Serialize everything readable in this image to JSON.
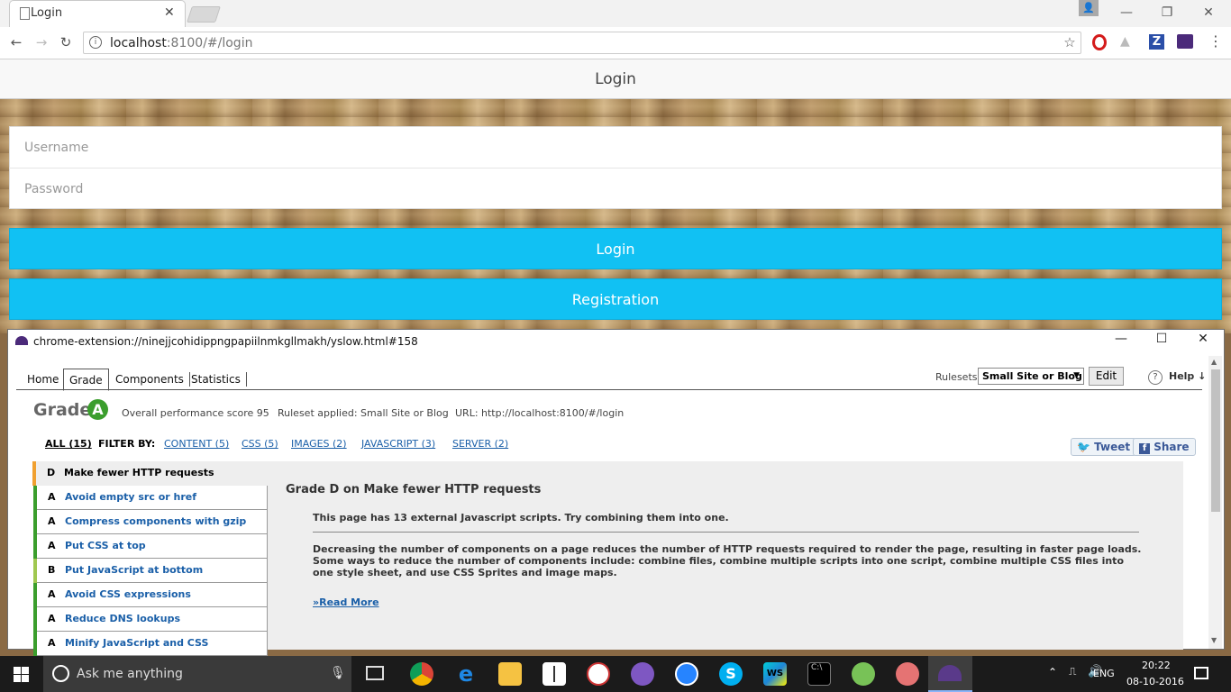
{
  "browser": {
    "tab_title": "Login",
    "url_host": "localhost",
    "url_rest": ":8100/#/login",
    "extensions": [
      "opera-icon",
      "drive-icon",
      "zotero-icon",
      "yslow-icon"
    ]
  },
  "app": {
    "header_title": "Login",
    "username_placeholder": "Username",
    "password_placeholder": "Password",
    "login_button": "Login",
    "registration_button": "Registration",
    "primary_color": "#11c1f3"
  },
  "popup": {
    "title": "chrome-extension://ninejjcohidippngpapiilnmkgllmakh/yslow.html#158",
    "tabs": [
      "Home",
      "Grade",
      "Components",
      "Statistics"
    ],
    "active_tab": "Grade",
    "rulesets_label": "Rulesets",
    "ruleset_value": "Small Site or Blog",
    "edit_button": "Edit",
    "help_label": "Help ↓",
    "grade_label": "Grade",
    "grade_letter": "A",
    "score_text": "Overall performance score 95",
    "ruleset_applied": "Ruleset applied: Small Site or Blog",
    "url_text": "URL: http://localhost:8100/#/login",
    "filter_all": "ALL (15)",
    "filter_by": "FILTER BY:",
    "filters": [
      "CONTENT (5)",
      "CSS (5)",
      "IMAGES (2)",
      "JAVASCRIPT (3)",
      "SERVER (2)"
    ],
    "tweet": "Tweet",
    "share": "Share",
    "rules": [
      {
        "grade": "D",
        "name": "Make fewer HTTP requests",
        "color": "#f0a030"
      },
      {
        "grade": "A",
        "name": "Avoid empty src or href",
        "color": "#3b9e2d"
      },
      {
        "grade": "A",
        "name": "Compress components with gzip",
        "color": "#3b9e2d"
      },
      {
        "grade": "A",
        "name": "Put CSS at top",
        "color": "#3b9e2d"
      },
      {
        "grade": "B",
        "name": "Put JavaScript at bottom",
        "color": "#a0c850"
      },
      {
        "grade": "A",
        "name": "Avoid CSS expressions",
        "color": "#3b9e2d"
      },
      {
        "grade": "A",
        "name": "Reduce DNS lookups",
        "color": "#3b9e2d"
      },
      {
        "grade": "A",
        "name": "Minify JavaScript and CSS",
        "color": "#3b9e2d"
      }
    ],
    "detail_heading": "Grade D on Make fewer HTTP requests",
    "detail_message": "This page has 13 external Javascript scripts. Try combining them into one.",
    "detail_description": "Decreasing the number of components on a page reduces the number of HTTP requests required to render the page, resulting in faster page loads. Some ways to reduce the number of components include: combine files, combine multiple scripts into one script, combine multiple CSS files into one style sheet, and use CSS Sprites and image maps.",
    "read_more": "»Read More"
  },
  "taskbar": {
    "search_placeholder": "Ask me anything",
    "language": "ENG",
    "time": "20:22",
    "date": "08-10-2016"
  }
}
